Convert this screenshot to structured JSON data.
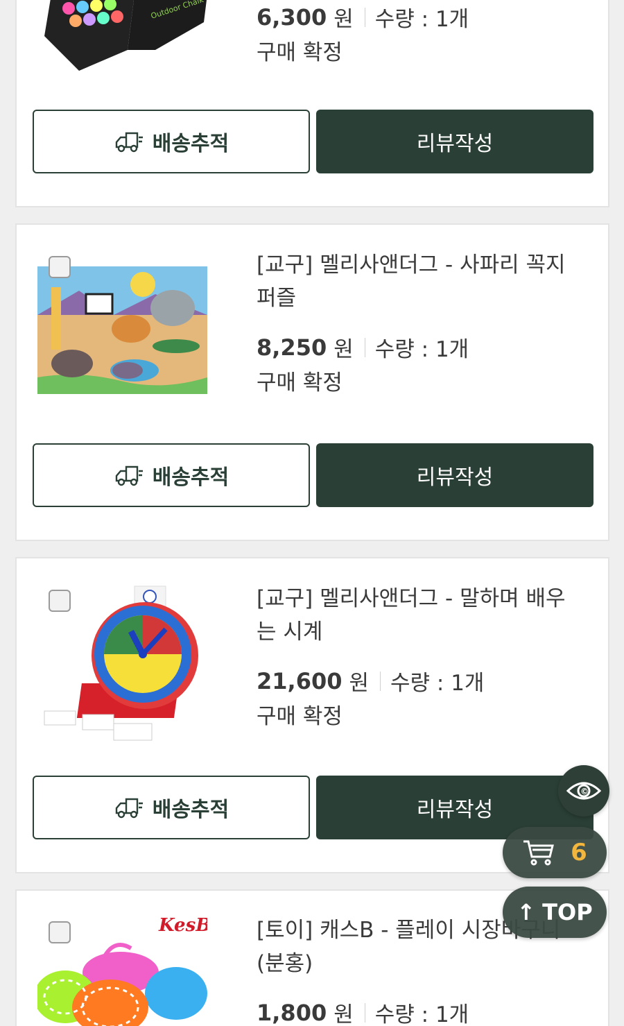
{
  "orders": [
    {
      "price": "6,300",
      "currency": "원",
      "qty_label": "수량 : 1개",
      "status": "구매 확정",
      "track_label": "배송추적",
      "review_label": "리뷰작성",
      "image": "outdoor-chalk-box"
    },
    {
      "title": "[교구] 멜리사앤더그 - 사파리 꼭지 퍼즐",
      "price": "8,250",
      "currency": "원",
      "qty_label": "수량 : 1개",
      "status": "구매 확정",
      "track_label": "배송추적",
      "review_label": "리뷰작성",
      "image": "safari-peg-puzzle"
    },
    {
      "title": "[교구] 멜리사앤더그 - 말하며 배우는 시계",
      "price": "21,600",
      "currency": "원",
      "qty_label": "수량 : 1개",
      "status": "구매 확정",
      "track_label": "배송추적",
      "review_label": "리뷰작성",
      "image": "teaching-clock"
    },
    {
      "title": "[토이] 캐스B - 플레이 시장바구니 (분홍)",
      "price": "1,800",
      "currency": "원",
      "qty_label": "수량 : 1개",
      "image": "play-market-baskets",
      "brand_logo": "KesB"
    }
  ],
  "floating": {
    "eye_icon": "eye-icon",
    "cart_count": "6",
    "top_label": "TOP"
  },
  "colors": {
    "primary": "#2a3f36",
    "badge": "#f2b233",
    "background": "#efefef"
  }
}
